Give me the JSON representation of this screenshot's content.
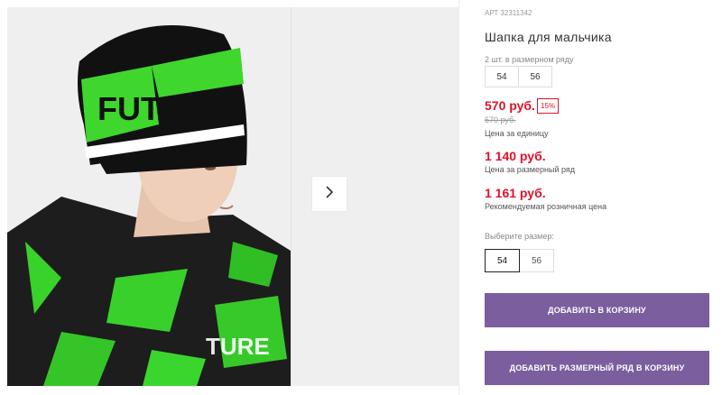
{
  "product": {
    "article": "АРТ 32311342",
    "title": "Шапка для мальчика",
    "pack_label": "2 шт. в размерном ряду",
    "pack_sizes": [
      "54",
      "56"
    ],
    "price": "570 руб.",
    "discount": "15%",
    "old_price": "670 руб.",
    "unit_price_label": "Цена за единицу",
    "row_price": "1 140 руб.",
    "row_price_label": "Цена за размерный ряд",
    "rrp_price": "1 161 руб.",
    "rrp_label": "Рекомендуемая розничная цена",
    "choose_size_label": "Выберите размер:",
    "sizes": [
      {
        "label": "54",
        "selected": true
      },
      {
        "label": "56",
        "selected": false
      }
    ],
    "add_to_cart": "Добавить в корзину",
    "add_row_to_cart": "Добавить размерный ряд в корзину"
  },
  "gallery": {
    "next_arrow_icon": "chevron-right-icon"
  },
  "colors": {
    "accent": "#7b5e9e",
    "price_red": "#e1112b"
  }
}
